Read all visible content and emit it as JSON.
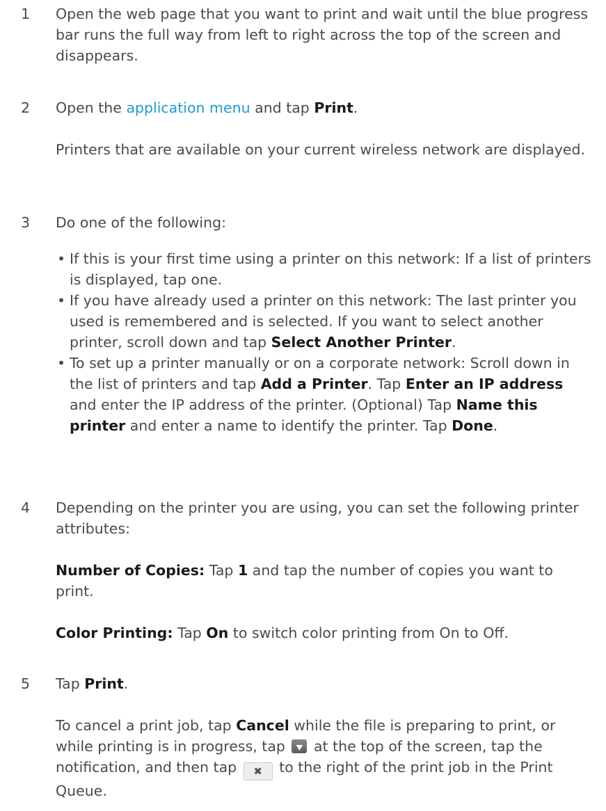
{
  "steps": [
    {
      "num": "1",
      "text": "Open the web page that you want to print and wait until the blue progress bar runs the full way from left to right across the top of the screen and disappears."
    },
    {
      "num": "2",
      "pre": "Open the ",
      "link": "application menu",
      "mid": " and tap ",
      "bold": "Print",
      "post": ".",
      "note": "Printers that are available on your current wireless network are displayed."
    },
    {
      "num": "3",
      "text": "Do one of the following:",
      "bullets": [
        {
          "text": "If this is your first time using a printer on this network: If a list of printers is displayed, tap one."
        },
        {
          "pre": "If you have already used a printer on this network: The last printer you used is remembered and is selected. If you want to select another printer, scroll down and tap ",
          "bold": "Select Another Printer",
          "post": "."
        },
        {
          "p1": "To set up a printer manually or on a corporate network: Scroll down in the list of printers and tap ",
          "b1": "Add a Printer",
          "p2": ". Tap ",
          "b2": "Enter an IP address",
          "p3": " and enter the IP address of the printer. (Optional) Tap ",
          "b3": "Name this printer",
          "p4": " and enter a name to identify the printer. Tap ",
          "b4": "Done",
          "p5": "."
        }
      ]
    },
    {
      "num": "4",
      "text": "Depending on the printer you are using, you can set the following printer attributes:",
      "copies": {
        "label": "Number of Copies:",
        "pre": " Tap ",
        "value": "1",
        "post": " and tap the number of copies you want to print."
      },
      "color": {
        "label": "Color Printing:",
        "pre": " Tap ",
        "value": "On",
        "post": " to switch color printing from On to Off."
      }
    },
    {
      "num": "5",
      "pre": "Tap ",
      "bold": "Print",
      "post": ".",
      "cancel": {
        "p1": "To cancel a print job, tap ",
        "b1": "Cancel",
        "p2": " while the file is preparing to print, or while printing is in progress, tap ",
        "icon1": "printer-notification-icon",
        "p3": " at the top of the screen, tap the notification, and then tap ",
        "icon2": "close-x-icon",
        "icon2_glyph": "✖",
        "p4": " to the right of the print job in the Print Queue."
      }
    }
  ]
}
